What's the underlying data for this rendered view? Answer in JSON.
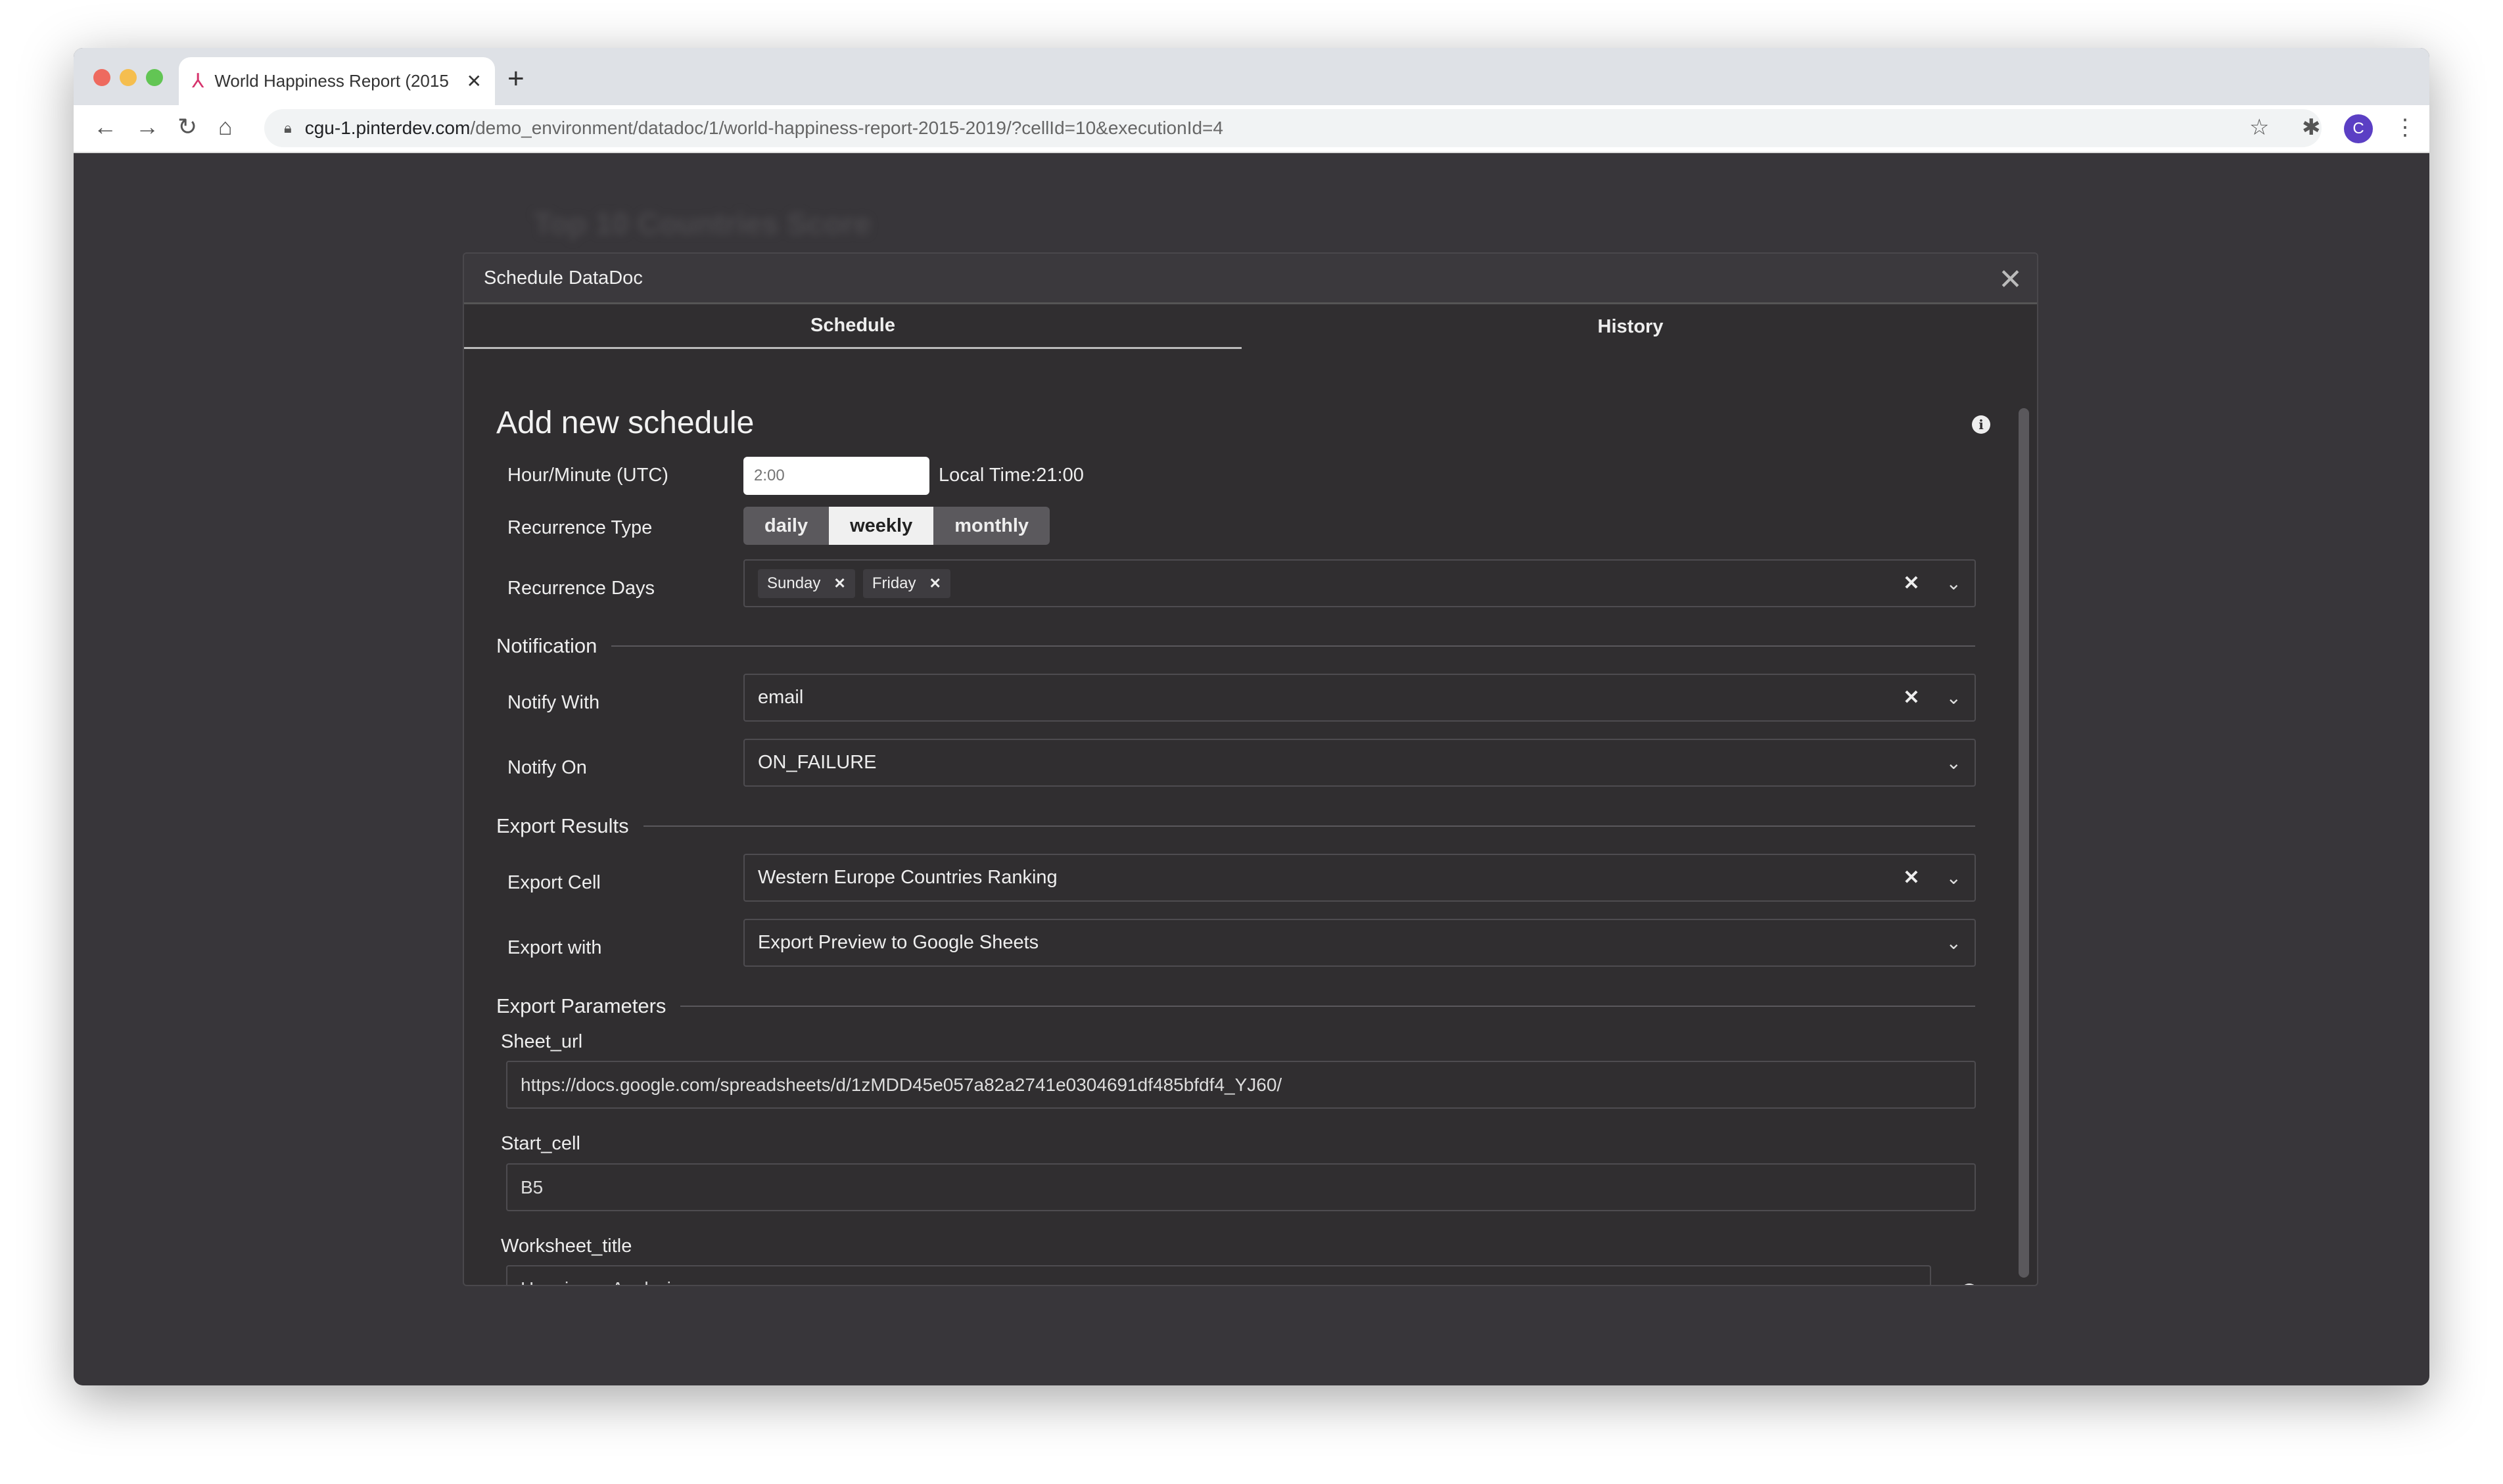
{
  "browser": {
    "tab_title": "World Happiness Report (2015",
    "url_host": "cgu-1.pinterdev.com",
    "url_path": "/demo_environment/datadoc/1/world-happiness-report-2015-2019/?cellId=10&executionId=4",
    "avatar_letter": "C"
  },
  "background": {
    "doc_title": "Top 10 Countries Score"
  },
  "modal": {
    "title": "Schedule DataDoc",
    "tabs": [
      {
        "label": "Schedule",
        "active": true
      },
      {
        "label": "History",
        "active": false
      }
    ],
    "heading": "Add new schedule",
    "hour_label": "Hour/Minute (UTC)",
    "hour_placeholder": "2:00",
    "local_time": "Local Time:21:00",
    "recurrence_type_label": "Recurrence Type",
    "recurrence_options": [
      "daily",
      "weekly",
      "monthly"
    ],
    "recurrence_selected": "weekly",
    "recurrence_days_label": "Recurrence Days",
    "recurrence_days": [
      "Sunday",
      "Friday"
    ],
    "notification_section": "Notification",
    "notify_with_label": "Notify With",
    "notify_with_value": "email",
    "notify_on_label": "Notify On",
    "notify_on_value": "ON_FAILURE",
    "export_section": "Export Results",
    "export_cell_label": "Export Cell",
    "export_cell_value": "Western Europe Countries Ranking",
    "export_with_label": "Export with",
    "export_with_value": "Export Preview to Google Sheets",
    "params_section": "Export Parameters",
    "sheet_url_label": "Sheet_url",
    "sheet_url_value": "https://docs.google.com/spreadsheets/d/1zMDD45e057a82a2741e0304691df485bfdf4_YJ60/",
    "start_cell_label": "Start_cell",
    "start_cell_value": "B5",
    "worksheet_title_label": "Worksheet_title",
    "worksheet_title_value": "Happiness Analysis"
  }
}
